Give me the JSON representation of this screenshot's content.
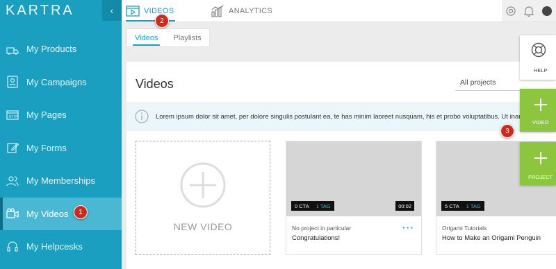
{
  "app": {
    "logo": "KARTRA"
  },
  "sidebar": {
    "collapse_glyph": "‹",
    "items": [
      {
        "label": "My Products",
        "icon": "products-icon"
      },
      {
        "label": "My Campaigns",
        "icon": "campaigns-icon"
      },
      {
        "label": "My Pages",
        "icon": "pages-icon"
      },
      {
        "label": "My Forms",
        "icon": "forms-icon"
      },
      {
        "label": "My Memberships",
        "icon": "memberships-icon"
      },
      {
        "label": "My Videos",
        "icon": "videos-icon",
        "active": true
      },
      {
        "label": "My Helpcesks",
        "icon": "helpdesks-icon"
      }
    ]
  },
  "topbar": {
    "tabs": [
      {
        "label": "VIDEOS",
        "icon": "video-play-icon",
        "active": true
      },
      {
        "label": "ANALYTICS",
        "icon": "analytics-icon"
      }
    ]
  },
  "subtabs": [
    {
      "label": "Videos",
      "active": true
    },
    {
      "label": "Playlists"
    }
  ],
  "panel": {
    "title": "Videos",
    "project_filter": "All projects",
    "info_text": "Lorem ipsum dolor sit amet, per dolore singulis postulant ea, te has minim laoreet nusquam, his et probo voluptatibus. Ut inani ...",
    "new_video_label": "NEW VIDEO"
  },
  "videos": [
    {
      "cta": "0 CTA",
      "tags": "1 TAG",
      "duration": "00:02",
      "project": "No project in particular",
      "title": "Congratulations!"
    },
    {
      "cta": "5 CTA",
      "tags": "1 TAG",
      "duration": "",
      "project": "Origami Tutorials",
      "title": "How to Make an Origami Penguin"
    }
  ],
  "floating": {
    "help_label": "HELP",
    "video_label": "VIDEO",
    "project_label": "PROJECT"
  },
  "markers": [
    "1",
    "2",
    "3"
  ],
  "colors": {
    "sidebar": "#1a9fc0",
    "accent": "#1a9fc0",
    "fab_green": "#8cc63f",
    "marker_red": "#d0291c"
  }
}
